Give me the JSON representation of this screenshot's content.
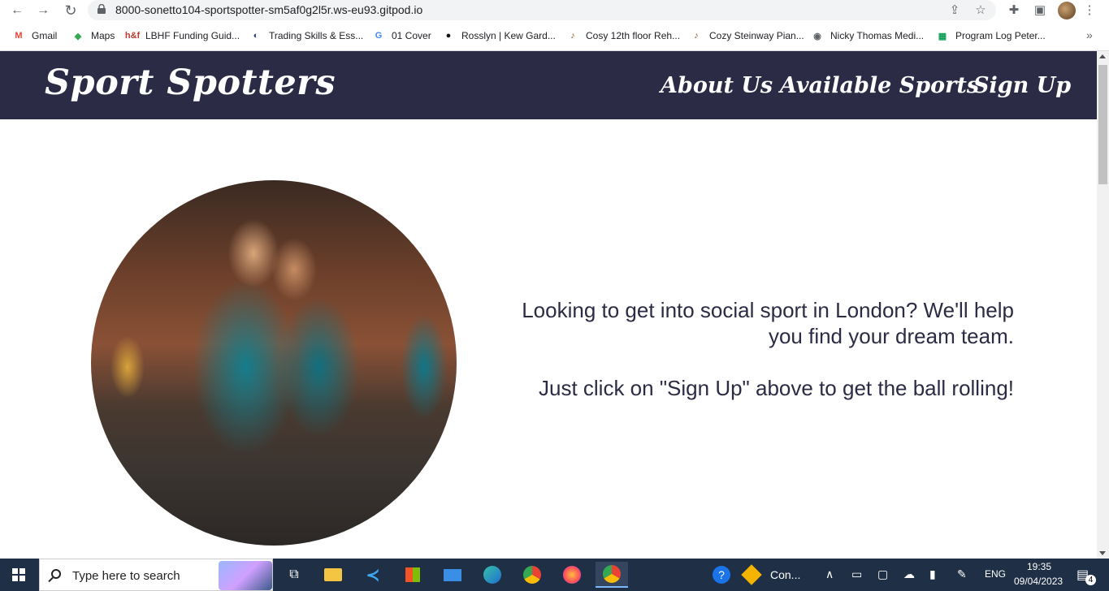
{
  "browser": {
    "url": "8000-sonetto104-sportspotter-sm5af0g2l5r.ws-eu93.gitpod.io",
    "bookmarks": [
      {
        "label": "Gmail",
        "icon": "gmail-icon",
        "color": "#ea4335",
        "glyph": "M"
      },
      {
        "label": "Maps",
        "icon": "maps-icon",
        "color": "#34a853",
        "glyph": "◆"
      },
      {
        "label": "LBHF Funding Guid...",
        "icon": "hf-icon",
        "color": "#c0392b",
        "glyph": "h&f"
      },
      {
        "label": "Trading Skills & Ess...",
        "icon": "trading-icon",
        "color": "#2c3e8f",
        "glyph": "◐"
      },
      {
        "label": "01 Cover",
        "icon": "google-icon",
        "color": "#4285f4",
        "glyph": "G"
      },
      {
        "label": "Rosslyn | Kew Gard...",
        "icon": "rosslyn-icon",
        "color": "#111111",
        "glyph": "●"
      },
      {
        "label": "Cosy 12th floor Reh...",
        "icon": "music-icon",
        "color": "#8b5a2b",
        "glyph": "♪"
      },
      {
        "label": "Cozy Steinway Pian...",
        "icon": "music-icon",
        "color": "#8b5a2b",
        "glyph": "♪"
      },
      {
        "label": "Nicky Thomas Medi...",
        "icon": "globe-icon",
        "color": "#5f6368",
        "glyph": "◉"
      },
      {
        "label": "Program Log Peter...",
        "icon": "sheets-icon",
        "color": "#0f9d58",
        "glyph": "▦"
      }
    ]
  },
  "site": {
    "logo": "Sport Spotters",
    "nav": [
      "About Us",
      "Available Sports",
      "Sign Up"
    ],
    "hero": {
      "line1": "Looking to get into social sport in London? We'll help you find your dream team.",
      "line2": "Just click on \"Sign Up\" above to get the ball rolling!"
    }
  },
  "taskbar": {
    "search_placeholder": "Type here to search",
    "active_app_label": "Con...",
    "lang": "ENG",
    "time": "19:35",
    "date": "09/04/2023",
    "notifications": "4"
  }
}
